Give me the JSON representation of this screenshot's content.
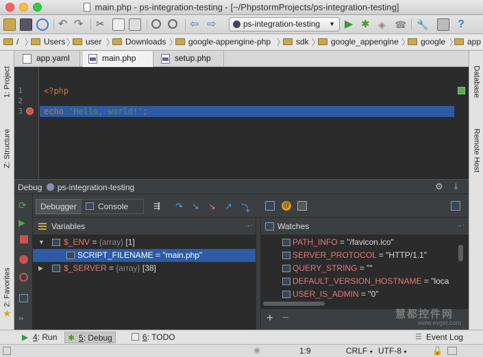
{
  "window": {
    "title": "main.php - ps-integration-testing - [~/PhpstormProjects/ps-integration-testing]"
  },
  "toolbar": {
    "run_config": "ps-integration-testing"
  },
  "breadcrumbs": [
    "/",
    "Users",
    "user",
    "Downloads",
    "google-appengine-php",
    "sdk",
    "google_appengine",
    "google",
    "app"
  ],
  "editor_tabs": [
    {
      "label": "app.yaml"
    },
    {
      "label": "main.php",
      "active": true
    },
    {
      "label": "setup.php"
    }
  ],
  "editor": {
    "line_numbers": [
      "1",
      "2",
      "3"
    ],
    "lines": [
      {
        "text": "<?php"
      },
      {
        "text": ""
      },
      {
        "keyword": "echo",
        "string": " 'Hello, world!'",
        "rest": ";",
        "breakpoint": true,
        "highlighted": true
      }
    ]
  },
  "left_tabs": {
    "project": "1: Project",
    "structure": "Z: Structure",
    "favorites": "2: Favorites"
  },
  "right_tabs": {
    "database": "Database",
    "remote_host": "Remote Host"
  },
  "debug": {
    "label": "Debug",
    "config": "ps-integration-testing",
    "tabs": {
      "debugger": "Debugger",
      "console": "Console"
    }
  },
  "variables": {
    "title": "Variables",
    "items": [
      {
        "name": "$_ENV",
        "eq": " = ",
        "type": "{array}",
        "extra": " [1]",
        "expanded": true
      },
      {
        "name": "SCRIPT_FILENAME",
        "eq": " = ",
        "value": "\"main.php\"",
        "selected": true
      },
      {
        "name": "$_SERVER",
        "eq": " = ",
        "type": "{array}",
        "extra": " [38]",
        "expanded": false
      }
    ]
  },
  "watches": {
    "title": "Watches",
    "items": [
      {
        "name": "PATH_INFO",
        "value": " = \"/favicon.ico\""
      },
      {
        "name": "SERVER_PROTOCOL",
        "value": " = \"HTTP/1.1\""
      },
      {
        "name": "QUERY_STRING",
        "value": " = \"\""
      },
      {
        "name": "DEFAULT_VERSION_HOSTNAME",
        "value": " = \"loca"
      },
      {
        "name": "USER_IS_ADMIN",
        "value": " = \"0\""
      }
    ],
    "add": "+",
    "remove": "−"
  },
  "watermark": {
    "line1": "慧都控件网",
    "line2": "www.evget.com"
  },
  "tool_windows": [
    {
      "num": "4",
      "label": ": Run"
    },
    {
      "num": "5",
      "label": ": Debug",
      "active": true
    },
    {
      "num": "6",
      "label": ": TODO"
    }
  ],
  "event_log": "Event Log",
  "status": {
    "position": "1:9",
    "line_sep": "CRLF",
    "encoding": "UTF-8"
  },
  "colors": {
    "selection": "#2d5ba5",
    "keyword": "#cc7832",
    "string": "#6a8759",
    "var_name": "#e27a76",
    "breakpoint": "#c75450"
  }
}
